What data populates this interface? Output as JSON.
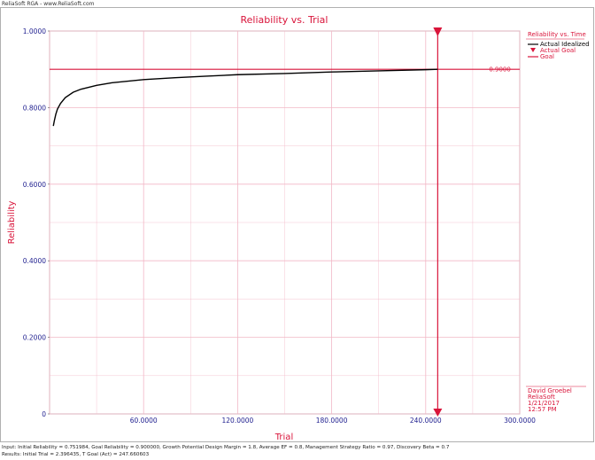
{
  "app": {
    "header": "ReliaSoft RGA - www.ReliaSoft.com"
  },
  "footer": {
    "input_line": "Input: Initial Reliability = 0.751984, Goal Reliability = 0.900000, Growth Potential Design Margin = 1.8, Average EF = 0.8, Management Strategy Ratio = 0.97, Discovery Beta = 0.7",
    "results_line": "Results: Initial Trial = 2.396435, T Goal (Act) = 247.660603"
  },
  "stamp": {
    "user": "David Groebel",
    "company": "ReliaSoft",
    "date": "1/21/2017",
    "time": "12:57 PM"
  },
  "colors": {
    "accent": "#d9143a",
    "axis_ticks": "#1f1f8f",
    "grid": "#f2b8c6",
    "curve": "#000000"
  },
  "chart_data": {
    "type": "line",
    "title": "Reliability vs. Trial",
    "xlabel": "Trial",
    "ylabel": "Reliability",
    "xlim": [
      0,
      300
    ],
    "ylim": [
      0,
      1
    ],
    "x_ticks": [
      "60.0000",
      "120.0000",
      "180.0000",
      "240.0000",
      "300.0000"
    ],
    "y_ticks": [
      "0",
      "0.2000",
      "0.4000",
      "0.6000",
      "0.8000",
      "1.0000"
    ],
    "grid": true,
    "legend": {
      "title": "Reliability vs. Time",
      "position": "top-right",
      "entries": [
        "Actual Idealized",
        "Actual Goal",
        "Goal"
      ]
    },
    "series": [
      {
        "name": "Actual Idealized",
        "x": [
          2.4,
          3,
          4,
          5,
          7,
          10,
          15,
          20,
          30,
          40,
          60,
          80,
          100,
          120,
          150,
          180,
          210,
          240,
          247.66
        ],
        "values": [
          0.752,
          0.765,
          0.783,
          0.796,
          0.811,
          0.826,
          0.84,
          0.848,
          0.858,
          0.865,
          0.873,
          0.878,
          0.882,
          0.886,
          0.889,
          0.893,
          0.896,
          0.899,
          0.9
        ]
      }
    ],
    "goal_value": 0.9,
    "goal_label": "0.9000",
    "goal_trial": 247.66
  }
}
